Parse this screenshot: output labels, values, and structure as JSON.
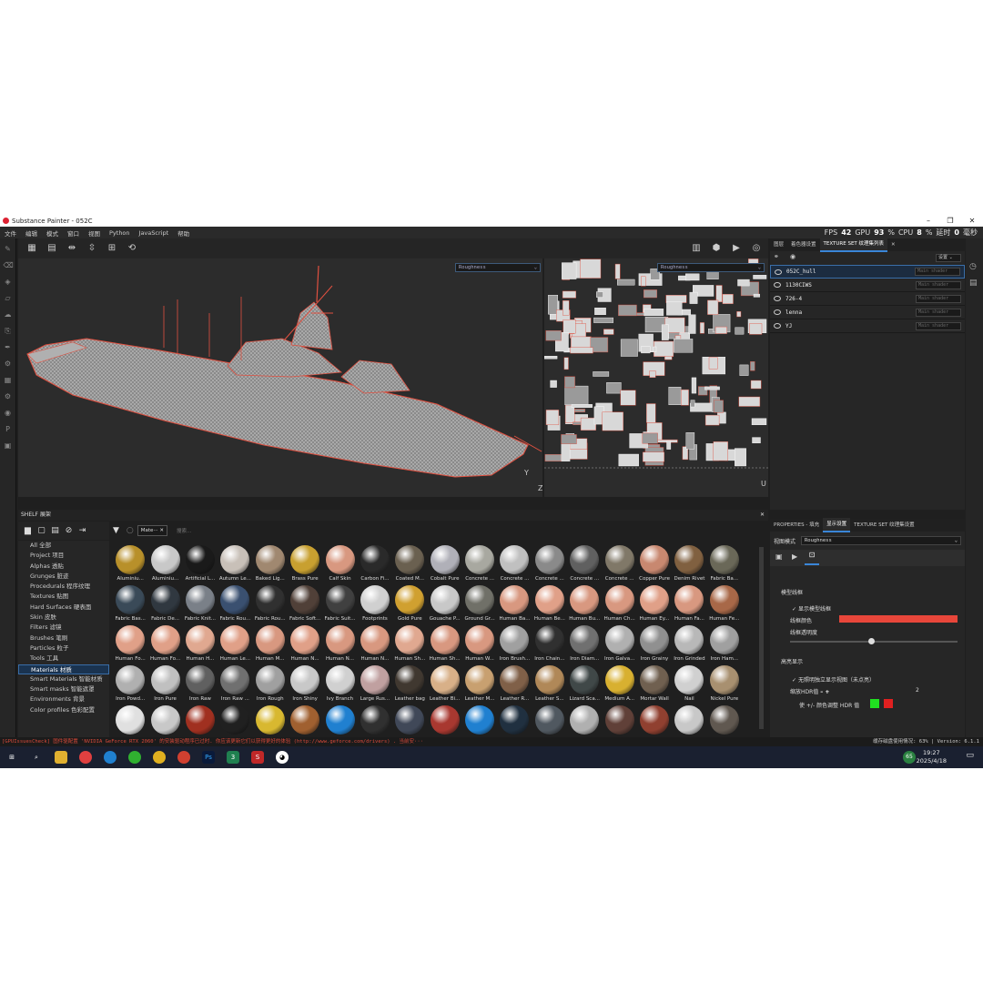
{
  "title": "Substance Painter - 052C",
  "menu": [
    "文件",
    "编辑",
    "模式",
    "窗口",
    "视图",
    "Python",
    "JavaScript",
    "帮助"
  ],
  "stats": {
    "fps_label": "FPS",
    "fps": "42",
    "gpu_label": "GPU",
    "gpu": "93",
    "gpu_unit": "%",
    "cpu_label": "CPU",
    "cpu": "8",
    "cpu_unit": "%",
    "latency_label": "延时",
    "latency": "0",
    "latency_unit": "毫秒"
  },
  "viewport": {
    "channel_3d": "Roughness",
    "channel_2d": "Roughness",
    "axis_y": "Y",
    "axis_z": "Z",
    "axis_u": "U"
  },
  "shelf": {
    "header": "SHELF 展架",
    "filter_chip": "Mate···",
    "search_placeholder": "搜索...",
    "categories": [
      "All 全部",
      "Project 项目",
      "Alphas 透贴",
      "Grunges 脏迹",
      "Procedurals 程序纹理",
      "Textures 贴图",
      "Hard Surfaces 硬表面",
      "Skin 皮肤",
      "Filters 滤镜",
      "Brushes 笔刷",
      "Particles 粒子",
      "Tools 工具",
      "Materials 材质",
      "Smart Materials 智能材质",
      "Smart masks 智能遮罩",
      "Environments 背景",
      "Color profiles 色彩配置"
    ],
    "selected_category": "Materials 材质",
    "materials": [
      {
        "label": "Aluminiu...",
        "color": "#b8902a"
      },
      {
        "label": "Aluminiu...",
        "color": "#c8c8c8"
      },
      {
        "label": "Artificial L...",
        "color": "#1a1a1a"
      },
      {
        "label": "Autumn Le...",
        "color": "#c8c0b8"
      },
      {
        "label": "Baked Lig...",
        "color": "#a08870"
      },
      {
        "label": "Brass Pure",
        "color": "#c8a030"
      },
      {
        "label": "Calf Skin",
        "color": "#d89880"
      },
      {
        "label": "Carbon Fi...",
        "color": "#2a2a2a"
      },
      {
        "label": "Coated M...",
        "color": "#6a6050"
      },
      {
        "label": "Cobalt Pure",
        "color": "#b0b0b8"
      },
      {
        "label": "Concrete ...",
        "color": "#a8a8a0"
      },
      {
        "label": "Concrete ...",
        "color": "#c0c0c0"
      },
      {
        "label": "Concrete ...",
        "color": "#8a8a8a"
      },
      {
        "label": "Concrete ...",
        "color": "#606060"
      },
      {
        "label": "Concrete ...",
        "color": "#807868"
      },
      {
        "label": "Copper Pure",
        "color": "#c88870"
      },
      {
        "label": "Denim Rivet",
        "color": "#806040"
      },
      {
        "label": "Fabric Ba...",
        "color": "#6a6858"
      },
      {
        "label": "Fabric Bas...",
        "color": "#3a4a58"
      },
      {
        "label": "Fabric De...",
        "color": "#303840"
      },
      {
        "label": "Fabric Knit...",
        "color": "#7a8088"
      },
      {
        "label": "Fabric Rou...",
        "color": "#3a5070"
      },
      {
        "label": "Fabric Rou...",
        "color": "#303030"
      },
      {
        "label": "Fabric Soft...",
        "color": "#504038"
      },
      {
        "label": "Fabric Suit...",
        "color": "#404040"
      },
      {
        "label": "Footprints",
        "color": "#d0d0d0"
      },
      {
        "label": "Gold Pure",
        "color": "#d0a030"
      },
      {
        "label": "Gouache P...",
        "color": "#c8c8c8"
      },
      {
        "label": "Ground Gr...",
        "color": "#707068"
      },
      {
        "label": "Human Ba...",
        "color": "#d89880"
      },
      {
        "label": "Human Be...",
        "color": "#e0a088"
      },
      {
        "label": "Human Bu...",
        "color": "#d89880"
      },
      {
        "label": "Human Ch...",
        "color": "#d89880"
      },
      {
        "label": "Human Ey...",
        "color": "#e0a088"
      },
      {
        "label": "Human Fa...",
        "color": "#d89880"
      },
      {
        "label": "Human Fe...",
        "color": "#a86848"
      },
      {
        "label": "Human Fo...",
        "color": "#e0a088"
      },
      {
        "label": "Human Fo...",
        "color": "#e0a088"
      },
      {
        "label": "Human H...",
        "color": "#e0a890"
      },
      {
        "label": "Human Le...",
        "color": "#e0a088"
      },
      {
        "label": "Human M...",
        "color": "#d89880"
      },
      {
        "label": "Human N...",
        "color": "#e0a088"
      },
      {
        "label": "Human N...",
        "color": "#d89880"
      },
      {
        "label": "Human N...",
        "color": "#d89880"
      },
      {
        "label": "Human Sh...",
        "color": "#e0a890"
      },
      {
        "label": "Human Sh...",
        "color": "#d89880"
      },
      {
        "label": "Human W...",
        "color": "#d89880"
      },
      {
        "label": "Iron Brush...",
        "color": "#a0a0a0"
      },
      {
        "label": "Iron Chain...",
        "color": "#303030"
      },
      {
        "label": "Iron Diam...",
        "color": "#707070"
      },
      {
        "label": "Iron Galva...",
        "color": "#b0b0b0"
      },
      {
        "label": "Iron Grainy",
        "color": "#909090"
      },
      {
        "label": "Iron Grinded",
        "color": "#b8b8b8"
      },
      {
        "label": "Iron Ham...",
        "color": "#a0a0a0"
      },
      {
        "label": "Iron Powd...",
        "color": "#b0b0b0"
      },
      {
        "label": "Iron Pure",
        "color": "#c0c0c0"
      },
      {
        "label": "Iron Raw",
        "color": "#606060"
      },
      {
        "label": "Iron Raw ...",
        "color": "#707070"
      },
      {
        "label": "Iron Rough",
        "color": "#a0a0a0"
      },
      {
        "label": "Iron Shiny",
        "color": "#c8c8c8"
      },
      {
        "label": "Ivy Branch",
        "color": "#d0d0d0"
      },
      {
        "label": "Large Rus...",
        "color": "#c0a0a0"
      },
      {
        "label": "Leather bag",
        "color": "#403830"
      },
      {
        "label": "Leather Bi...",
        "color": "#d8b088"
      },
      {
        "label": "Leather M...",
        "color": "#c8a070"
      },
      {
        "label": "Leather R...",
        "color": "#806048"
      },
      {
        "label": "Leather S...",
        "color": "#b08858"
      },
      {
        "label": "Lizard Sca...",
        "color": "#404848"
      },
      {
        "label": "Medium A...",
        "color": "#d8b030"
      },
      {
        "label": "Mortar Wall",
        "color": "#706050"
      },
      {
        "label": "Nail",
        "color": "#d0d0d0"
      },
      {
        "label": "Nickel Pure",
        "color": "#a89070"
      },
      {
        "label": "",
        "color": "#e0e0e0"
      },
      {
        "label": "",
        "color": "#c8c8c8"
      },
      {
        "label": "",
        "color": "#a03020"
      },
      {
        "label": "",
        "color": "#202020"
      },
      {
        "label": "",
        "color": "#d8b830"
      },
      {
        "label": "",
        "color": "#a06030"
      },
      {
        "label": "",
        "color": "#2080d0"
      },
      {
        "label": "",
        "color": "#303030"
      },
      {
        "label": "",
        "color": "#404858"
      },
      {
        "label": "",
        "color": "#a83830"
      },
      {
        "label": "",
        "color": "#2080d0"
      },
      {
        "label": "",
        "color": "#203040"
      },
      {
        "label": "",
        "color": "#505860"
      },
      {
        "label": "",
        "color": "#b0b0b0"
      },
      {
        "label": "",
        "color": "#604038"
      },
      {
        "label": "",
        "color": "#904030"
      },
      {
        "label": "",
        "color": "#c8c8c8"
      },
      {
        "label": "",
        "color": "#605850"
      }
    ]
  },
  "right_panel": {
    "tabs": [
      "图层",
      "着色器设置",
      "TEXTURE SET 纹理集列表"
    ],
    "settings_label": "设置",
    "texture_sets": [
      {
        "name": "052C_hull",
        "shader": "Main shader"
      },
      {
        "name": "1130CIWS",
        "shader": "Main shader"
      },
      {
        "name": "726-4",
        "shader": "Main shader"
      },
      {
        "name": "lenna",
        "shader": "Main shader"
      },
      {
        "name": "YJ",
        "shader": "Main shader"
      }
    ],
    "selected_set": "052C_hull"
  },
  "props_panel": {
    "tabs": [
      "PROPERTIES - 填充",
      "显示设置",
      "TEXTURE SET 纹理集设置"
    ],
    "view_mode_label": "视图模式",
    "view_mode_value": "Roughness",
    "section_wire": "模型线框",
    "show_wire": "显示模型线框",
    "wire_color": "线框颜色",
    "wire_opacity": "线框透明度",
    "section_hl": "高亮显示",
    "hl_option": "无照明独立显示视图（未点亮）",
    "hdr_label": "缩放HDR值",
    "hdr_value": "2",
    "color_adjust": "使 +/- 颜色调整 HDR 值",
    "wire_color_hex": "#e8463a"
  },
  "console": {
    "message": "[GPUIssuesCheck] 固件驱配置 'NVIDIA GeForce RTX 2060' 的安装驱动程序已过时. 你应该更新它们以获得更好的体验 (http://www.geforce.com/drivers) . 当前安···",
    "status": "缓存磁盘使用情况: 63% | Version: 6.1.1"
  },
  "taskbar": {
    "time": "19:27",
    "date": "2025/4/18",
    "badge": "65"
  }
}
